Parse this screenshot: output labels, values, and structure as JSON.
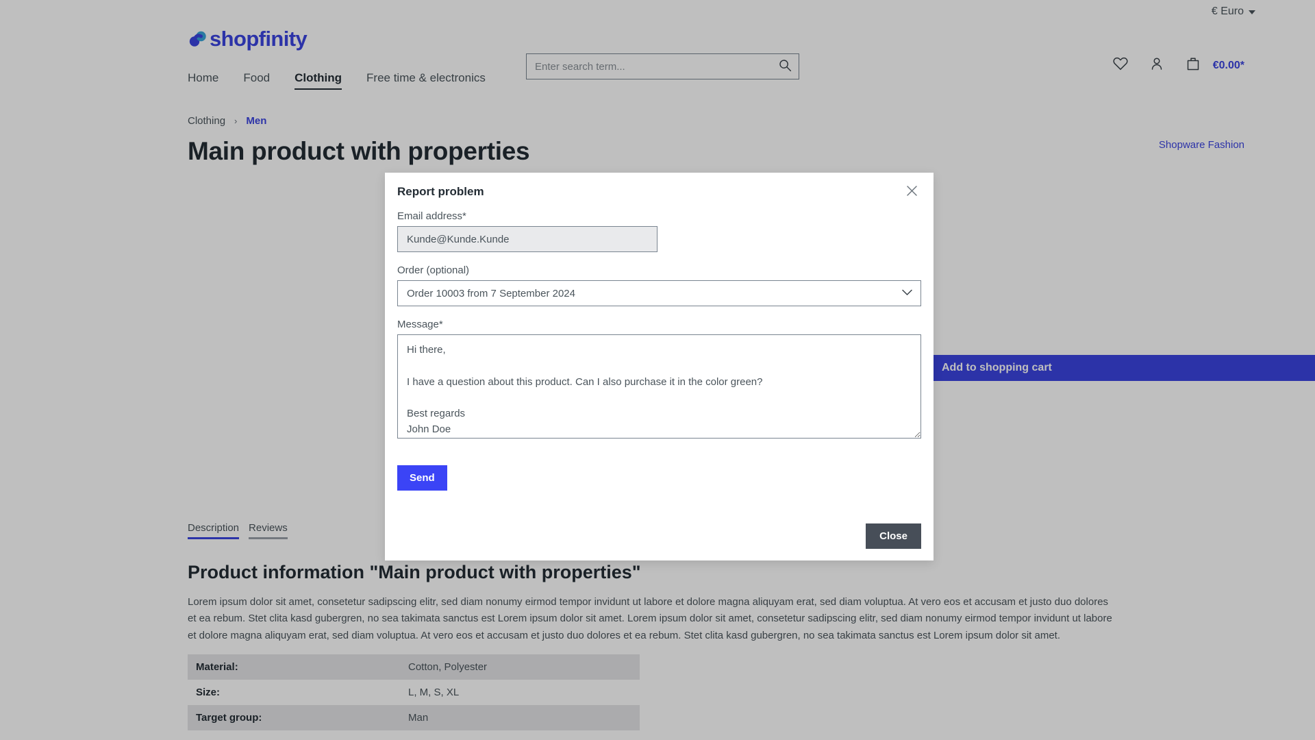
{
  "topbar": {
    "currency": "€ Euro",
    "currency_icon": "chevron-down-icon"
  },
  "header": {
    "logo_text": "shopfinity",
    "logo_icon": "infinity-logo-icon",
    "search": {
      "placeholder": "Enter search term...",
      "value": "",
      "icon": "search-icon"
    },
    "actions": {
      "wishlist_icon": "heart-icon",
      "account_icon": "person-icon",
      "cart_icon": "shopping-bag-icon",
      "cart_total": "€0.00*"
    }
  },
  "nav": {
    "items": [
      {
        "label": "Home",
        "active": false
      },
      {
        "label": "Food",
        "active": false
      },
      {
        "label": "Clothing",
        "active": true
      },
      {
        "label": "Free time & electronics",
        "active": false
      }
    ]
  },
  "breadcrumb": {
    "separator": "›",
    "items": [
      {
        "label": "Clothing",
        "current": false
      },
      {
        "label": "Men",
        "current": true
      }
    ]
  },
  "product": {
    "title": "Main product with properties",
    "manufacturer": "Shopware Fashion",
    "add_to_cart_label": "Add to shopping cart"
  },
  "tabs": [
    {
      "label": "Description",
      "active": true
    },
    {
      "label": "Reviews",
      "active": false
    }
  ],
  "description": {
    "heading": "Product information \"Main product with properties\"",
    "body": "Lorem ipsum dolor sit amet, consetetur sadipscing elitr, sed diam nonumy eirmod tempor invidunt ut labore et dolore magna aliquyam erat, sed diam voluptua. At vero eos et accusam et justo duo dolores et ea rebum. Stet clita kasd gubergren, no sea takimata sanctus est Lorem ipsum dolor sit amet. Lorem ipsum dolor sit amet, consetetur sadipscing elitr, sed diam nonumy eirmod tempor invidunt ut labore et dolore magna aliquyam erat, sed diam voluptua. At vero eos et accusam et justo duo dolores et ea rebum. Stet clita kasd gubergren, no sea takimata sanctus est Lorem ipsum dolor sit amet."
  },
  "properties": {
    "rows": [
      {
        "key": "Material:",
        "value": "Cotton, Polyester"
      },
      {
        "key": "Size:",
        "value": "L, M, S, XL"
      },
      {
        "key": "Target group:",
        "value": "Man"
      }
    ]
  },
  "modal": {
    "title": "Report problem",
    "close_icon": "close-icon",
    "email": {
      "label": "Email address*",
      "value": "Kunde@Kunde.Kunde"
    },
    "order": {
      "label": "Order (optional)",
      "selected": "Order 10003 from 7 September 2024",
      "options": [
        "Order 10003 from 7 September 2024"
      ],
      "chevron_icon": "chevron-down-icon"
    },
    "message": {
      "label": "Message*",
      "value": "Hi there,\n\nI have a question about this product. Can I also purchase it in the color green?\n\nBest regards\nJohn Doe"
    },
    "send_label": "Send",
    "close_label": "Close"
  },
  "colors": {
    "brand": "#3b44e0",
    "send_button": "#3b44f6",
    "close_button": "#474e58",
    "text": "#4a545b",
    "heading": "#232c34"
  }
}
